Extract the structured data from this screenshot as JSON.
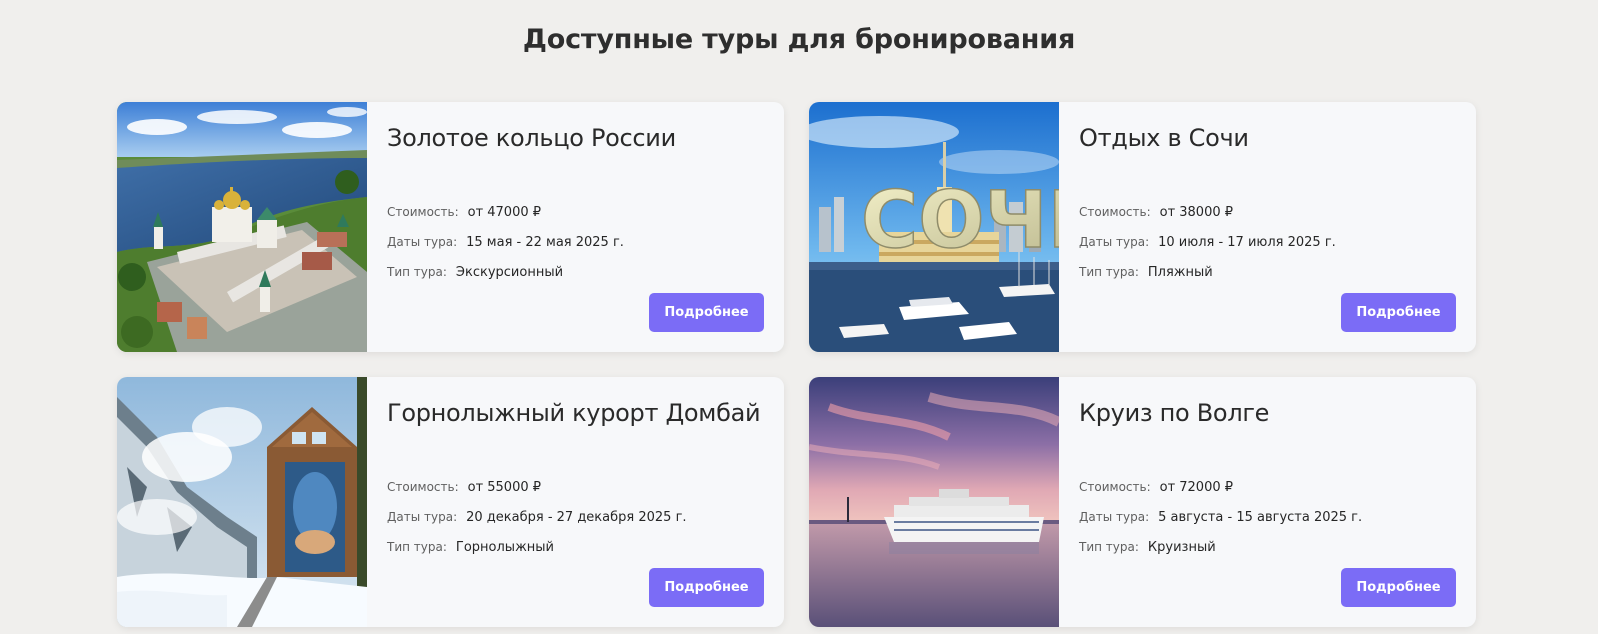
{
  "page": {
    "title": "Доступные туры для бронирования"
  },
  "labels": {
    "price": "Стоимость:",
    "dates": "Даты тура:",
    "type": "Тип тура:"
  },
  "tours": [
    {
      "title": "Золотое кольцо России",
      "price": "от 47000 ₽",
      "dates": "15 мая - 22 мая 2025 г.",
      "type": "Экскурсионный",
      "button": "Подробнее",
      "image": "monastery-aerial-photo"
    },
    {
      "title": "Отдых в Сочи",
      "price": "от 38000 ₽",
      "dates": "10 июля - 17 июля 2025 г.",
      "type": "Пляжный",
      "button": "Подробнее",
      "image": "sochi-port-photo",
      "image_text": "СОЧИ"
    },
    {
      "title": "Горнолыжный курорт Домбай",
      "price": "от 55000 ₽",
      "dates": "20 декабря - 27 декабря 2025 г.",
      "type": "Горнолыжный",
      "button": "Подробнее",
      "image": "snowy-mountain-photo"
    },
    {
      "title": "Круиз по Волге",
      "price": "от 72000 ₽",
      "dates": "5 августа - 15 августа 2025 г.",
      "type": "Круизный",
      "button": "Подробнее",
      "image": "river-cruise-ship-photo"
    }
  ],
  "colors": {
    "button": "#7b6cf6",
    "background": "#f0efed",
    "card": "#f7f8fa"
  }
}
